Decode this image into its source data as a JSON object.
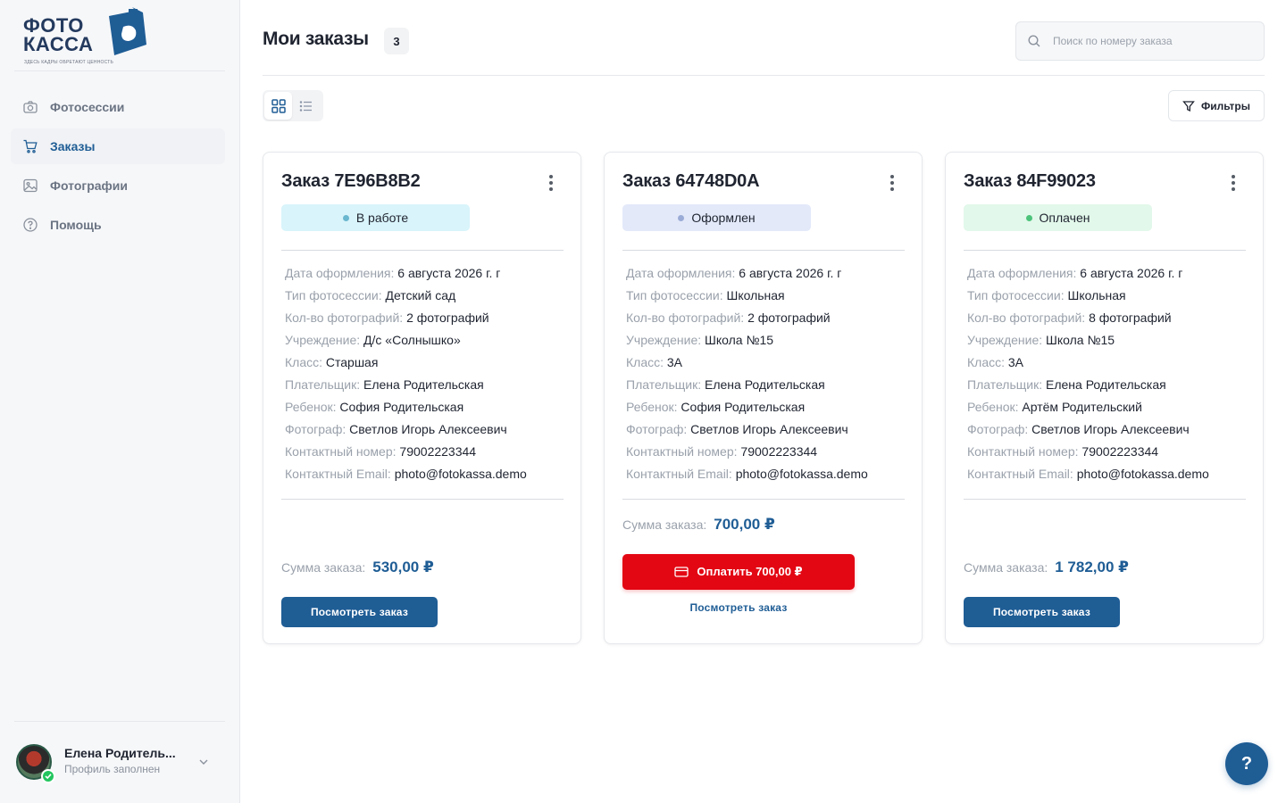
{
  "brand": {
    "logo_line1": "ФОТО",
    "logo_line2": "КАССА",
    "tagline": "ЗДЕСЬ КАДРЫ ОБРЕТАЮТ ЦЕННОСТЬ",
    "color": "#243a5e",
    "accent": "#1f5d95"
  },
  "sidebar": {
    "items": [
      {
        "label": "Фотосессии",
        "icon": "camera-icon",
        "active": false
      },
      {
        "label": "Заказы",
        "icon": "cart-icon",
        "active": true
      },
      {
        "label": "Фотографии",
        "icon": "image-icon",
        "active": false
      },
      {
        "label": "Помощь",
        "icon": "help-circle-icon",
        "active": false
      }
    ],
    "profile": {
      "name": "Елена Родитель...",
      "status": "Профиль заполнен"
    }
  },
  "header": {
    "title": "Мои заказы",
    "count": "3",
    "search_placeholder": "Поиск по номеру заказа"
  },
  "toolbar": {
    "filters_label": "Фильтры"
  },
  "orders": [
    {
      "title": "Заказ 7E96B8B2",
      "status": "В работе",
      "status_bg": "#d9f4fb",
      "status_dot": "#6ab7cf",
      "details": [
        {
          "k": "Дата оформления:",
          "v": "6 августа 2026 г. г"
        },
        {
          "k": "Тип фотосессии:",
          "v": "Детский сад"
        },
        {
          "k": "Кол-во фотографий:",
          "v": "2 фотографий"
        },
        {
          "k": "Учреждение:",
          "v": "Д/с «Солнышко»"
        },
        {
          "k": "Класс:",
          "v": "Старшая"
        },
        {
          "k": "Плательщик:",
          "v": "Елена Родительская"
        },
        {
          "k": "Ребенок:",
          "v": "София Родительская"
        },
        {
          "k": "Фотограф:",
          "v": "Светлов Игорь Алексеевич"
        },
        {
          "k": "Контактный номер:",
          "v": "79002223344"
        },
        {
          "k": "Контактный Email:",
          "v": "photo@fotokassa.demo"
        }
      ],
      "sum_label": "Сумма заказа:",
      "sum_value": "530,00 ₽",
      "view_label": "Посмотреть заказ"
    },
    {
      "title": "Заказ 64748D0A",
      "status": "Оформлен",
      "status_bg": "#e3e9f9",
      "status_dot": "#9aabd6",
      "details": [
        {
          "k": "Дата оформления:",
          "v": "6 августа 2026 г. г"
        },
        {
          "k": "Тип фотосессии:",
          "v": "Школьная"
        },
        {
          "k": "Кол-во фотографий:",
          "v": "2 фотографий"
        },
        {
          "k": "Учреждение:",
          "v": "Школа №15"
        },
        {
          "k": "Класс:",
          "v": "3А"
        },
        {
          "k": "Плательщик:",
          "v": "Елена Родительская"
        },
        {
          "k": "Ребенок:",
          "v": "София Родительская"
        },
        {
          "k": "Фотограф:",
          "v": "Светлов Игорь Алексеевич"
        },
        {
          "k": "Контактный номер:",
          "v": "79002223344"
        },
        {
          "k": "Контактный Email:",
          "v": "photo@fotokassa.demo"
        }
      ],
      "sum_label": "Сумма заказа:",
      "sum_value": "700,00 ₽",
      "pay_label": "Оплатить 700,00 ₽",
      "view_label": "Посмотреть заказ"
    },
    {
      "title": "Заказ 84F99023",
      "status": "Оплачен",
      "status_bg": "#e2f8ea",
      "status_dot": "#4cc37a",
      "details": [
        {
          "k": "Дата оформления:",
          "v": "6 августа 2026 г. г"
        },
        {
          "k": "Тип фотосессии:",
          "v": "Школьная"
        },
        {
          "k": "Кол-во фотографий:",
          "v": "8 фотографий"
        },
        {
          "k": "Учреждение:",
          "v": "Школа №15"
        },
        {
          "k": "Класс:",
          "v": "3А"
        },
        {
          "k": "Плательщик:",
          "v": "Елена Родительская"
        },
        {
          "k": "Ребенок:",
          "v": "Артём Родительский"
        },
        {
          "k": "Фотограф:",
          "v": "Светлов Игорь Алексеевич"
        },
        {
          "k": "Контактный номер:",
          "v": "79002223344"
        },
        {
          "k": "Контактный Email:",
          "v": "photo@fotokassa.demo"
        }
      ],
      "sum_label": "Сумма заказа:",
      "sum_value": "1 782,00 ₽",
      "view_label": "Посмотреть заказ"
    }
  ],
  "help_fab": "?"
}
